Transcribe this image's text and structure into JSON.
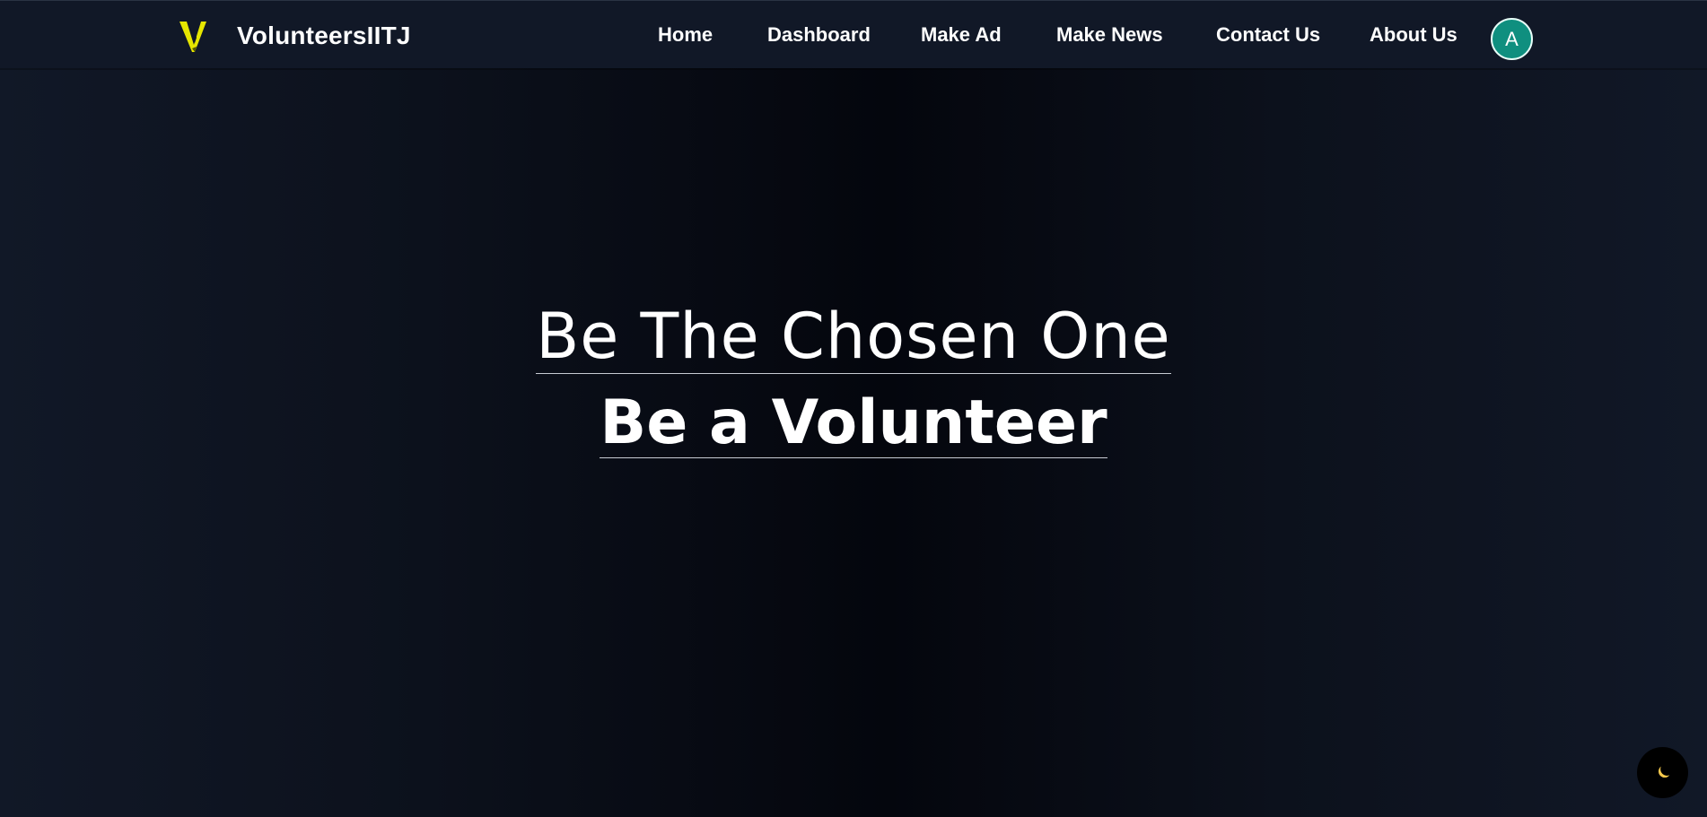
{
  "header": {
    "brand_name": "VolunteersIITJ",
    "logo_icon": "v-logo-icon",
    "nav": [
      {
        "label": "Home"
      },
      {
        "label": "Dashboard"
      },
      {
        "label": "Make Ad"
      },
      {
        "label": "Make News"
      },
      {
        "label": "Contact Us"
      },
      {
        "label": "About Us"
      }
    ],
    "avatar_initial": "A",
    "avatar_color": "#0f8f7f"
  },
  "hero": {
    "line1": "Be The Chosen One",
    "line2": "Be a Volunteer"
  },
  "theme_toggle": {
    "icon": "moon-icon"
  },
  "colors": {
    "background": "#111827",
    "accent_logo": "#e6e600",
    "text": "#ffffff"
  }
}
